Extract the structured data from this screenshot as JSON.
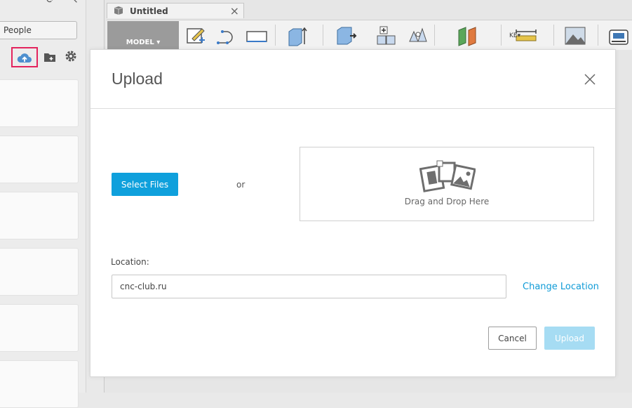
{
  "left_panel": {
    "people_tab_label": "People",
    "icons": {
      "refresh": "refresh-icon",
      "search": "search-icon",
      "upload": "cloud-upload-icon",
      "new_folder": "new-folder-icon",
      "settings": "gear-icon"
    },
    "file_card_count": 6
  },
  "document_tab": {
    "title": "Untitled",
    "close_glyph": "×"
  },
  "toolbar": {
    "workspace_label": "MODEL ▾",
    "make_label": "KE▾"
  },
  "upload_dialog": {
    "title": "Upload",
    "select_files_label": "Select Files",
    "or_label": "or",
    "drop_zone_label": "Drag and Drop Here",
    "location_label": "Location:",
    "location_value": "cnc-club.ru",
    "change_location_label": "Change Location",
    "cancel_label": "Cancel",
    "upload_label": "Upload"
  },
  "colors": {
    "accent": "#0fa0dc",
    "highlight_box": "#e3245d",
    "upload_disabled": "#a6dcf3"
  }
}
